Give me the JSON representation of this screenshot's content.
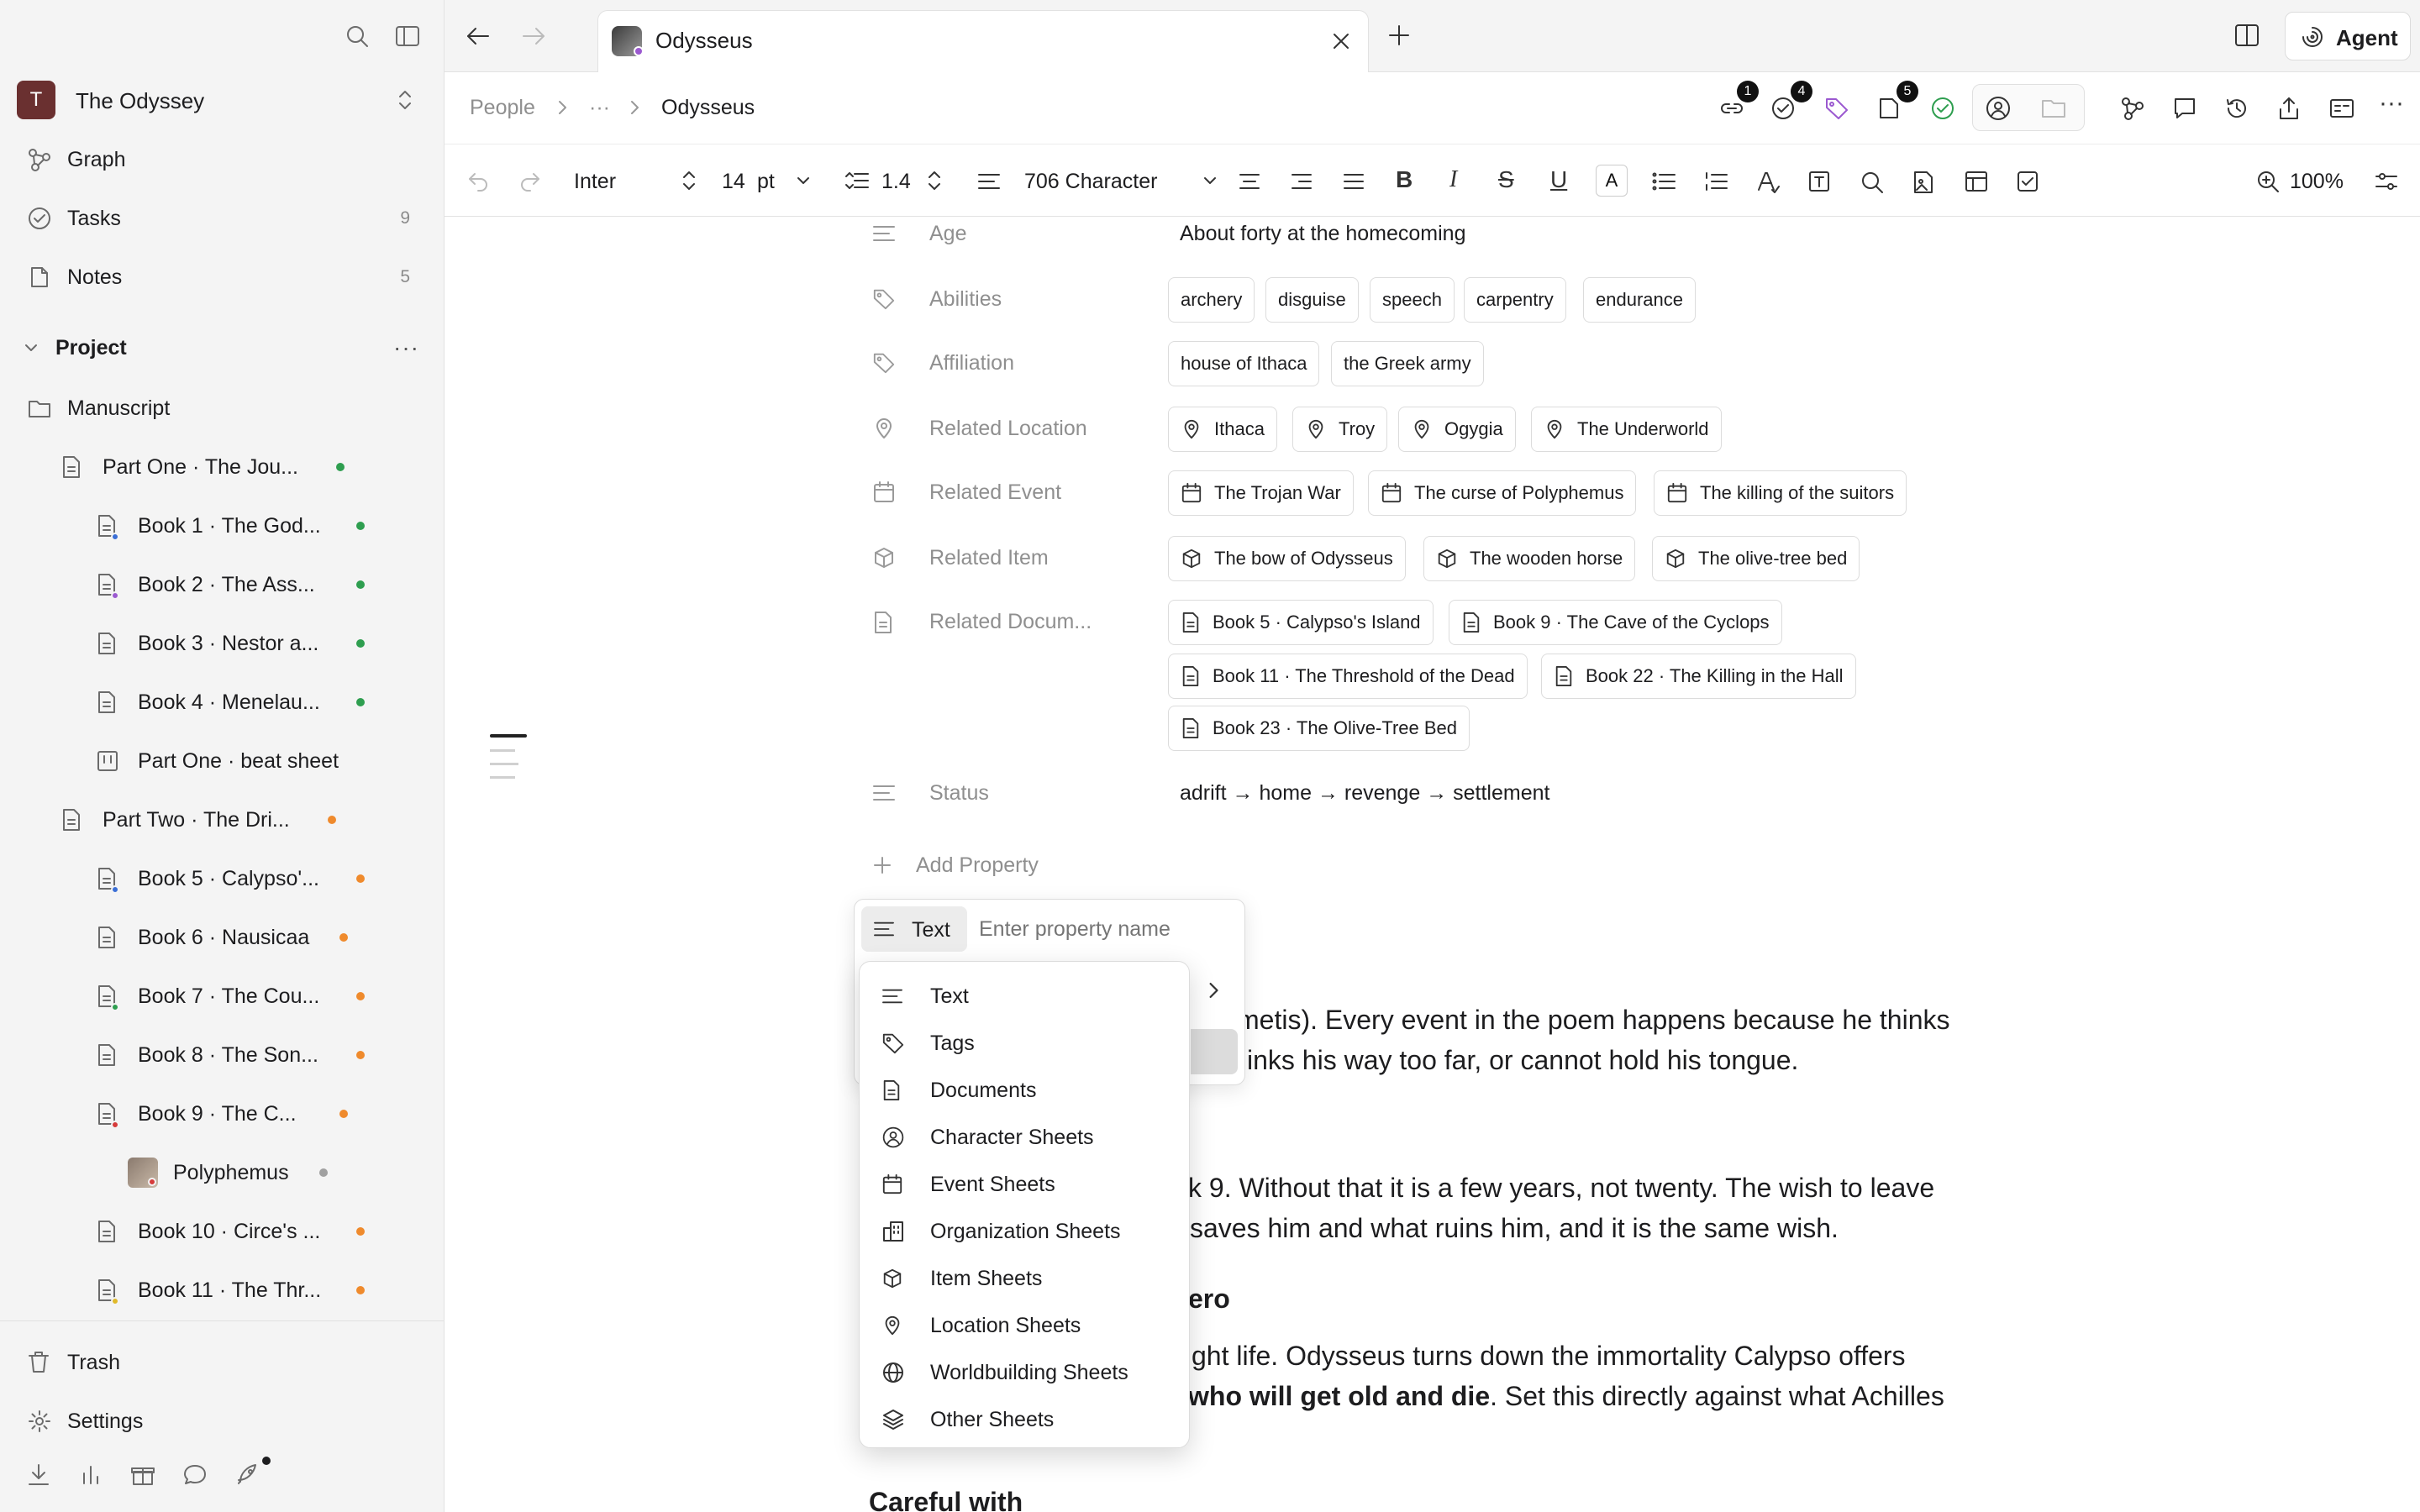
{
  "workspace": {
    "initial": "T",
    "name": "The Odyssey"
  },
  "sidebar": {
    "nav": [
      {
        "label": "Graph",
        "count": ""
      },
      {
        "label": "Tasks",
        "count": "9"
      },
      {
        "label": "Notes",
        "count": "5"
      }
    ],
    "project_label": "Project",
    "tree": [
      {
        "label": "Manuscript"
      },
      {
        "label": "Part One · The Jou...",
        "dot": "#2e9e4f"
      },
      {
        "label": "Book 1 · The God...",
        "dot": "#2e9e4f",
        "sub": "#3b6fd6"
      },
      {
        "label": "Book 2 · The Ass...",
        "dot": "#2e9e4f",
        "sub": "#9b59d0"
      },
      {
        "label": "Book 3 · Nestor a...",
        "dot": "#2e9e4f"
      },
      {
        "label": "Book 4 · Menelau...",
        "dot": "#2e9e4f"
      },
      {
        "label": "Part One · beat sheet"
      },
      {
        "label": "Part Two · The Dri...",
        "dot": "#ef8a2c"
      },
      {
        "label": "Book 5 · Calypso'...",
        "dot": "#ef8a2c",
        "sub": "#3b6fd6"
      },
      {
        "label": "Book 6 · Nausicaa",
        "dot": "#ef8a2c"
      },
      {
        "label": "Book 7 · The Cou...",
        "dot": "#ef8a2c",
        "sub": "#2e9e4f"
      },
      {
        "label": "Book 8 · The Son...",
        "dot": "#ef8a2c"
      },
      {
        "label": "Book 9 · The C...",
        "dot": "#ef8a2c",
        "sub": "#d63b3b"
      },
      {
        "label": "Polyphemus",
        "dot": "#a0a0a0"
      },
      {
        "label": "Book 10 · Circe's ...",
        "dot": "#ef8a2c"
      },
      {
        "label": "Book 11 · The Thr...",
        "dot": "#ef8a2c",
        "sub": "#e0b92a"
      }
    ],
    "trash_label": "Trash",
    "settings_label": "Settings"
  },
  "tab": {
    "title": "Odysseus"
  },
  "agent_label": "Agent",
  "breadcrumb": {
    "root": "People",
    "ellipsis": "···",
    "current": "Odysseus"
  },
  "header_badges": {
    "links": "1",
    "tasks": "4",
    "docs": "5"
  },
  "toolbar": {
    "font": "Inter",
    "size": "14",
    "size_unit": "pt",
    "line_height": "1.4",
    "style": "706 Character",
    "zoom": "100%"
  },
  "properties": [
    {
      "label": "Age",
      "value": "About forty at the homecoming"
    },
    {
      "label": "Abilities",
      "chips": [
        "archery",
        "disguise",
        "speech",
        "carpentry",
        "endurance"
      ]
    },
    {
      "label": "Affiliation",
      "chips": [
        "house of Ithaca",
        "the Greek army"
      ]
    },
    {
      "label": "Related Location",
      "chips": [
        "Ithaca",
        "Troy",
        "Ogygia",
        "The Underworld"
      ]
    },
    {
      "label": "Related Event",
      "chips": [
        "The Trojan War",
        "The curse of Polyphemus",
        "The killing of the suitors"
      ]
    },
    {
      "label": "Related Item",
      "chips": [
        "The bow of Odysseus",
        "The wooden horse",
        "The olive-tree bed"
      ]
    },
    {
      "label": "Related Docum...",
      "chips": [
        "Book 5 · Calypso's Island",
        "Book 9 · The Cave of the Cyclops",
        "Book 11 · The Threshold of the Dead",
        "Book 22 · The Killing in the Hall",
        "Book 23 · The Olive-Tree Bed"
      ]
    },
    {
      "label": "Status",
      "value": "adrift → home → revenge → settlement"
    }
  ],
  "add_property_label": "Add Property",
  "prop_editor": {
    "type_label": "Text",
    "placeholder": "Enter property name"
  },
  "type_menu": [
    "Text",
    "Tags",
    "Documents",
    "Character Sheets",
    "Event Sheets",
    "Organization Sheets",
    "Item Sheets",
    "Location Sheets",
    "Worldbuilding Sheets",
    "Other Sheets"
  ],
  "body": {
    "line1": "metis). Every event in the poem happens because he thinks",
    "line2": "inks his way too far, or cannot hold his tongue.",
    "line3": "k 9. Without that it is a few years, not twenty. The wish to leave",
    "line4": "saves him and what ruins him, and it is the same wish.",
    "heading": "ero",
    "line5": "ght life. Odysseus turns down the immortality Calypso offers",
    "line6_bold": "who will get old and die",
    "line6_rest": ". Set this directly against what Achilles",
    "heading2": "Careful with"
  },
  "colors": {
    "accent_green": "#2e9e4f",
    "accent_orange": "#ef8a2c",
    "tag_purple": "#9b59d0"
  }
}
